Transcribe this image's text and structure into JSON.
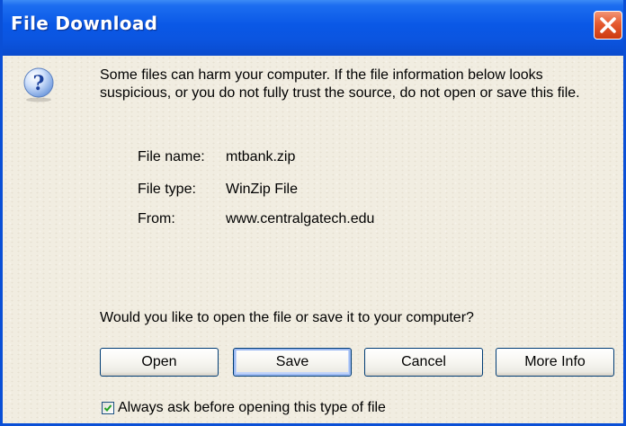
{
  "window": {
    "title": "File Download"
  },
  "icons": {
    "title_close": "close-icon",
    "dialog": "question-icon",
    "checkbox": "checkmark-icon"
  },
  "colors": {
    "titlebar": "#0a58e6",
    "close_button": "#e55a2f",
    "dialog_background": "#f1ede1",
    "button_border": "#003c74",
    "focus_highlight": "#9dbaf2"
  },
  "warning": {
    "text": "Some files can harm your computer. If the file information below looks suspicious, or you do not fully trust the source, do not open or save this file."
  },
  "file_info": {
    "name_label": "File name:",
    "name_value": "mtbank.zip",
    "type_label": "File type:",
    "type_value": "WinZip File",
    "from_label": "From:",
    "from_value": "www.centralgatech.edu"
  },
  "question": {
    "text": "Would you like to open the file or save it to your computer?"
  },
  "buttons": {
    "open": "Open",
    "save": "Save",
    "cancel": "Cancel",
    "more_info": "More Info"
  },
  "checkbox": {
    "label": "Always ask before opening this type of file",
    "checked": true
  }
}
